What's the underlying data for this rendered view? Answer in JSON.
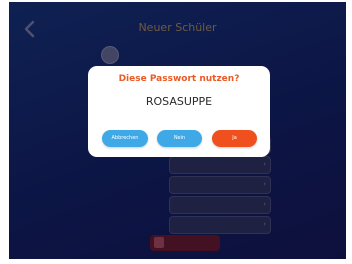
{
  "header": {
    "title": "Neuer Schüler"
  },
  "form": {
    "fields": [
      {
        "label": "",
        "value": ""
      },
      {
        "label": "",
        "value": ""
      },
      {
        "label": "",
        "value": ""
      },
      {
        "label": "",
        "value": ""
      },
      {
        "label": "",
        "value": ""
      }
    ]
  },
  "create_button": {
    "label": ""
  },
  "dialog": {
    "title": "Diese Passwort nutzen?",
    "password": "ROSASUPPE",
    "buttons": {
      "cancel": "Abbrechen",
      "no": "Nein",
      "yes": "Ja"
    }
  },
  "colors": {
    "accent_orange": "#f0501e",
    "button_blue": "#3fa9e8",
    "background_navy": "#17286e"
  },
  "icons": {
    "back": "chevron-left-icon",
    "avatar": "avatar-icon"
  }
}
